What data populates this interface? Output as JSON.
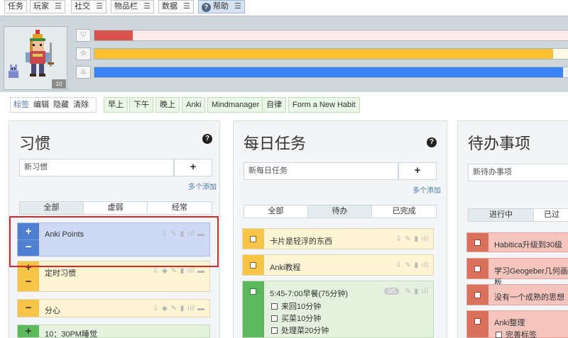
{
  "nav": {
    "tasks": "任务",
    "players": "玩家",
    "social": "社交",
    "inventory": "物品栏",
    "data": "数据",
    "help": "帮助",
    "menu_glyph": "☰"
  },
  "avatar": {
    "level": "10"
  },
  "stats": {
    "health": {
      "icon": "♡",
      "fraction": 0.08,
      "color": "#d9534f",
      "track": "#fde9e9"
    },
    "experience": {
      "icon": "☆",
      "fraction": 0.96,
      "color": "#fbc02d",
      "track": "#fff9e5"
    },
    "mana": {
      "icon": "♨",
      "fraction": 0.98,
      "color": "#3b82f6",
      "track": "#e8f0fe"
    }
  },
  "filters": {
    "tag_group": [
      "标签",
      "编辑",
      "隐藏",
      "清除"
    ],
    "tags": [
      "早上",
      "下午",
      "晚上",
      "Anki",
      "Mindmanager",
      "自律",
      "Form a New Habit"
    ]
  },
  "habits": {
    "title": "习惯",
    "help": "?",
    "placeholder": "新习惯",
    "add": "+",
    "multi_add": "多个添加",
    "tabs": [
      "全部",
      "虚弱",
      "经常"
    ],
    "items": [
      {
        "label": "Anki Points",
        "plus": "+",
        "minus": "−",
        "actions": "⇩ ✎ ▮ ıll ▬"
      },
      {
        "label": "定时习惯",
        "plus": "+",
        "minus": "−",
        "actions": "⇩ ◆ ✎ ▮ ıll ▬"
      },
      {
        "label": "分心",
        "minus": "−",
        "actions": "⇩ ◆ ✎ ▮ ıll ▬"
      },
      {
        "label": "10：30PM睡觉",
        "plus": "+"
      }
    ]
  },
  "dailies": {
    "title": "每日任务",
    "help": "?",
    "placeholder": "新每日任务",
    "add": "+",
    "multi_add": "多个添加",
    "tabs": [
      "全部",
      "待办",
      "已完成"
    ],
    "items": [
      {
        "label": "卡片是轻浮的东西",
        "actions": "⇩ ✎ ▮ ıll"
      },
      {
        "label": "Anki教程",
        "actions": "⇩ ✎ ▮ ıll"
      },
      {
        "label": "5:45-7:00早餐(75分钟)",
        "badge": "0/5",
        "actions": "✎ ▮ ıll",
        "checklist": [
          "来回10分钟",
          "买菜10分钟",
          "处理菜20分钟"
        ]
      }
    ]
  },
  "todos": {
    "title": "待办事项",
    "placeholder": "新待办事项",
    "tabs": [
      "进行中",
      "已过"
    ],
    "items": [
      {
        "label": "Habitica升级到30级"
      },
      {
        "label": "学习Geogeber几何画板"
      },
      {
        "label": "没有一个成熟的思想"
      },
      {
        "label": "Anki整理",
        "checklist": [
          "完善标签"
        ]
      }
    ]
  }
}
